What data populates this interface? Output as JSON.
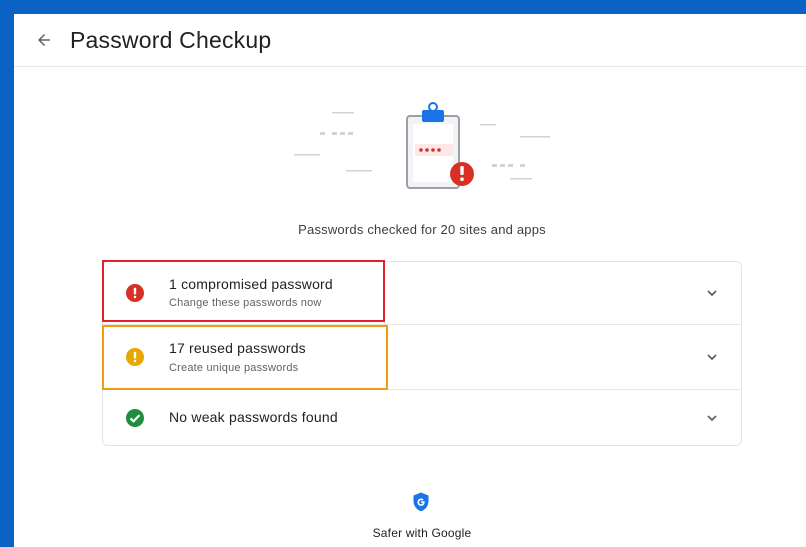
{
  "header": {
    "title": "Password Checkup",
    "back_icon": "arrow-back-icon"
  },
  "hero": {
    "icon": "clipboard-password-alert-illustration",
    "dots_label": "****"
  },
  "summary": {
    "text": "Passwords checked for 20 sites and apps"
  },
  "results": [
    {
      "title": "1 compromised password",
      "subtitle": "Change these passwords now",
      "icon": "error-icon",
      "color": "#d93025"
    },
    {
      "title": "17 reused passwords",
      "subtitle": "Create unique passwords",
      "icon": "warning-icon",
      "color": "#e8a600"
    },
    {
      "title": "No weak passwords found",
      "subtitle": "",
      "icon": "check-circle-icon",
      "color": "#1e8e3e"
    }
  ],
  "footer": {
    "icon": "google-shield-icon",
    "text": "Safer with Google"
  },
  "colors": {
    "frame": "#0a63c4",
    "highlight_red": "#e0202c",
    "highlight_orange": "#f39c12"
  }
}
